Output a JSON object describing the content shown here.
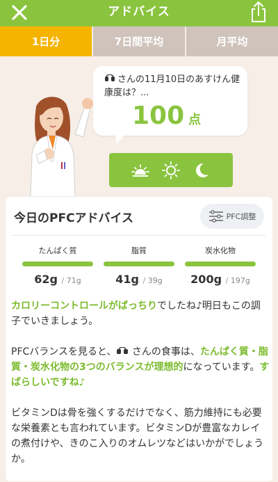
{
  "header": {
    "title": "アドバイス",
    "close_icon": "close-icon",
    "share_icon": "share-icon"
  },
  "tabs": [
    {
      "label": "1日分",
      "active": true
    },
    {
      "label": "7日間平均",
      "active": false
    },
    {
      "label": "月平均",
      "active": false
    }
  ],
  "hero": {
    "bubble_line": "さんの11月10日のあすけん健康度は？...",
    "score": "100",
    "score_unit": "点",
    "time_icons": [
      "sunrise-icon",
      "sun-icon",
      "moon-icon"
    ]
  },
  "card": {
    "title": "今日のPFCアドバイス",
    "pfc_button_label": "PFC調整",
    "nutrients": [
      {
        "label": "たんぱく質",
        "value": "62g",
        "target": "71g",
        "fill": 1.0
      },
      {
        "label": "脂質",
        "value": "41g",
        "target": "39g",
        "fill": 1.0
      },
      {
        "label": "炭水化物",
        "value": "200g",
        "target": "197g",
        "fill": 1.0
      }
    ],
    "advice": {
      "p1_highlight": "カロリーコントロールがばっちり",
      "p1_rest": "でしたね♪明日もこの調子でいきましょう。",
      "p2_a": "PFCバランスを見ると、",
      "p2_b": "さんの食事は、",
      "p2_highlight1": "たんぱく質・脂質・炭水化物の3つのバランスが理想的",
      "p2_c": "になっています。",
      "p2_highlight2": "すばらしいですね♪",
      "p3": "ビタミンDは骨を強くするだけでなく、筋力維持にも必要な栄養素とも言われています。ビタミンDが豊富なカレイの煮付けや、きのこ入りのオムレツなどはいかがでしょうか。"
    }
  },
  "colors": {
    "green": "#8ac43f",
    "tab_active": "#f5b400",
    "tab_inactive": "#cfc3bb",
    "background": "#f6eee7"
  }
}
